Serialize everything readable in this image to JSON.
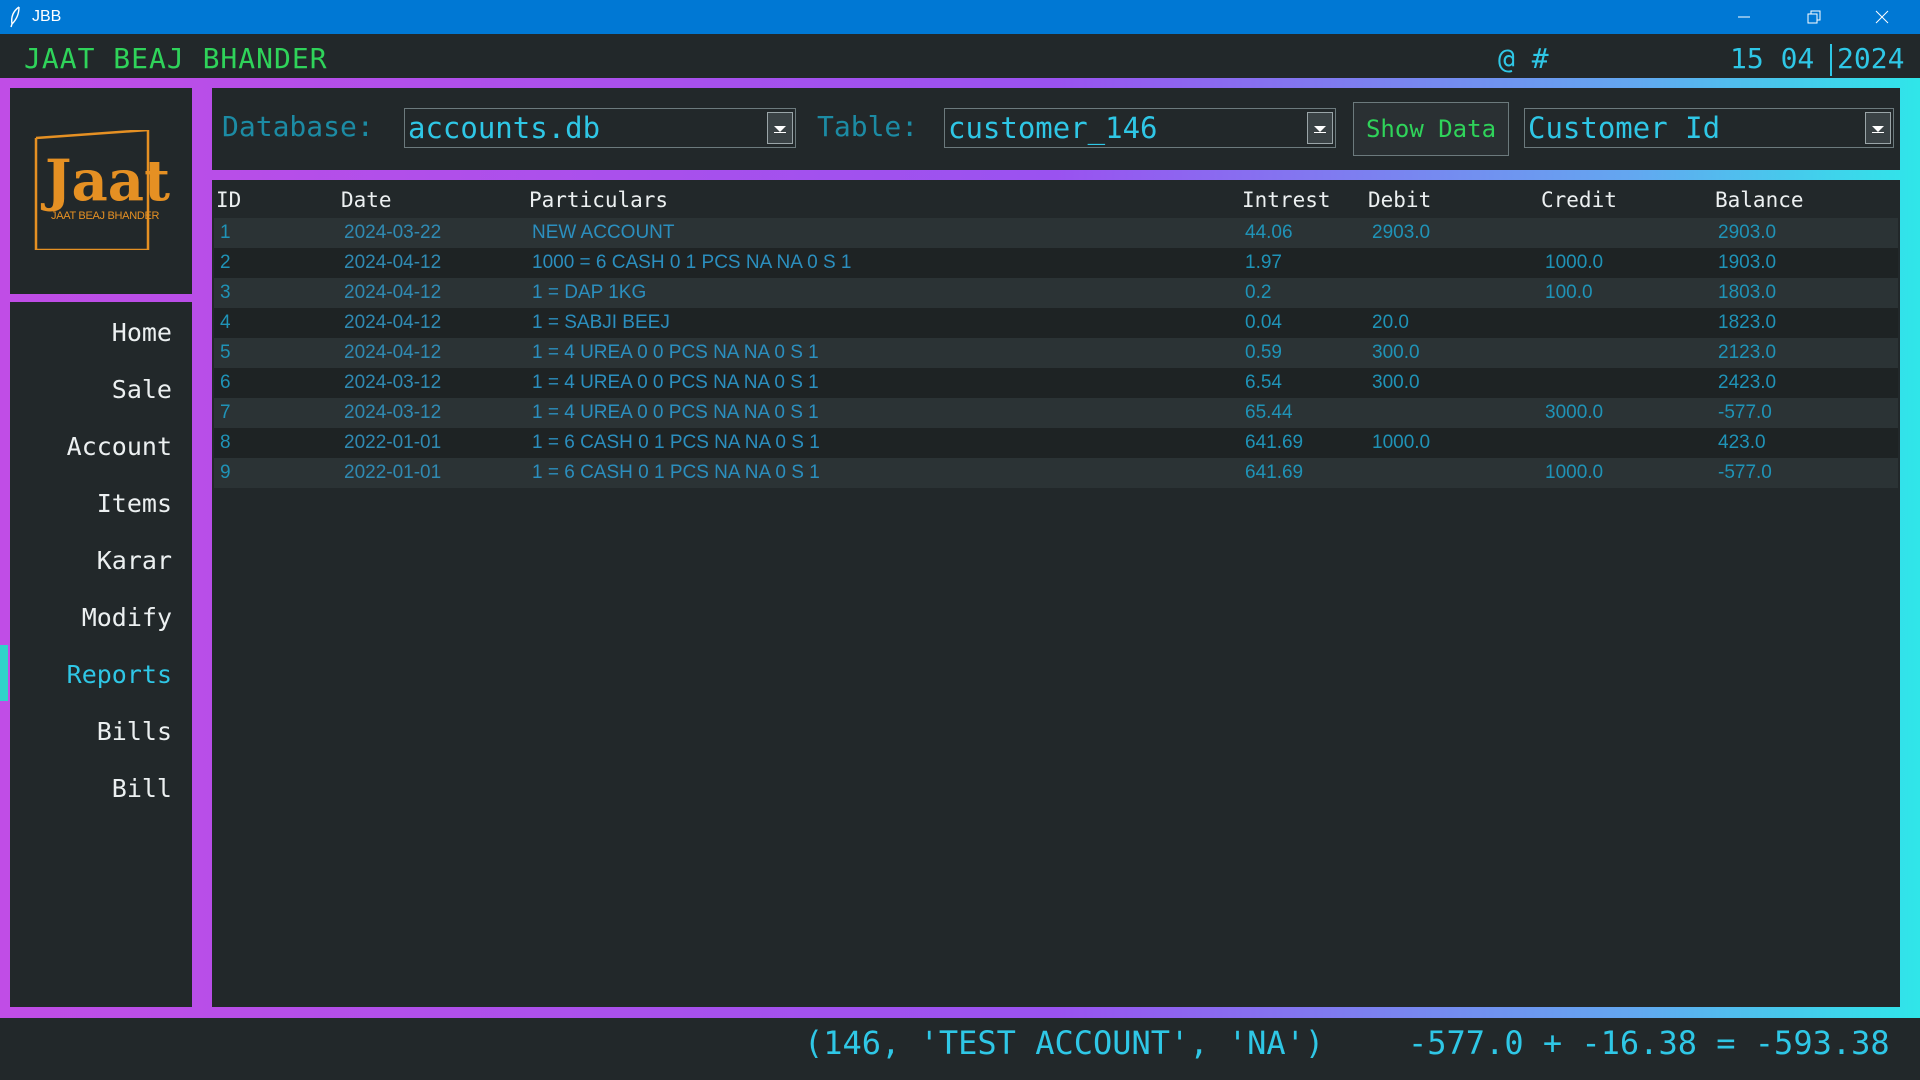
{
  "window": {
    "title": "JBB"
  },
  "header": {
    "brand": "JAAT BEAJ BHANDER",
    "symbols": "@ #",
    "date_day_month": "15 04",
    "date_year": "2024"
  },
  "logo": {
    "text": "Jaat",
    "subtitle": "JAAT BEAJ BHANDER",
    "color": "#e59023"
  },
  "sidebar": {
    "items": [
      {
        "label": "Home"
      },
      {
        "label": "Sale"
      },
      {
        "label": "Account"
      },
      {
        "label": "Items"
      },
      {
        "label": "Karar"
      },
      {
        "label": "Modify"
      },
      {
        "label": "Reports"
      },
      {
        "label": "Bills"
      },
      {
        "label": "Bill"
      }
    ],
    "active": "Reports"
  },
  "toolbar": {
    "database_label": "Database:",
    "database_value": "accounts.db",
    "table_label": "Table:",
    "table_value": "customer_146",
    "show_button": "Show Data",
    "sort_value": "Customer Id"
  },
  "table": {
    "columns": [
      "ID",
      "Date",
      "Particulars",
      "Intrest",
      "Debit",
      "Credit",
      "Balance"
    ],
    "rows": [
      [
        "1",
        "2024-03-22",
        "NEW ACCOUNT",
        "44.06",
        "2903.0",
        "",
        "2903.0"
      ],
      [
        "2",
        "2024-04-12",
        "1000 = 6 CASH 0 1 PCS NA NA 0 S 1",
        "1.97",
        "",
        "1000.0",
        "1903.0"
      ],
      [
        "3",
        "2024-04-12",
        "1 = DAP 1KG",
        "0.2",
        "",
        "100.0",
        "1803.0"
      ],
      [
        "4",
        "2024-04-12",
        "1 = SABJI BEEJ",
        "0.04",
        "20.0",
        "",
        "1823.0"
      ],
      [
        "5",
        "2024-04-12",
        "1 = 4 UREA 0 0 PCS NA NA 0 S 1",
        "0.59",
        "300.0",
        "",
        "2123.0"
      ],
      [
        "6",
        "2024-03-12",
        "1 = 4 UREA 0 0 PCS NA NA 0 S 1",
        "6.54",
        "300.0",
        "",
        "2423.0"
      ],
      [
        "7",
        "2024-03-12",
        "1 = 4 UREA 0 0 PCS NA NA 0 S 1",
        "65.44",
        "",
        "3000.0",
        "-577.0"
      ],
      [
        "8",
        "2022-01-01",
        "1 = 6 CASH 0 1 PCS NA NA 0 S 1",
        "641.69",
        "1000.0",
        "",
        "423.0"
      ],
      [
        "9",
        "2022-01-01",
        "1 = 6 CASH 0 1 PCS NA NA 0 S 1",
        "641.69",
        "",
        "1000.0",
        "-577.0"
      ]
    ]
  },
  "status": {
    "account": "(146, 'TEST ACCOUNT', 'NA')",
    "summary": "-577.0 + -16.38 = -593.38"
  },
  "colors": {
    "accent_cyan": "#2fc7e6",
    "brand_green": "#2fd35a",
    "gradient": [
      "#c04de6",
      "#9a52f0",
      "#2fe6e9"
    ]
  }
}
